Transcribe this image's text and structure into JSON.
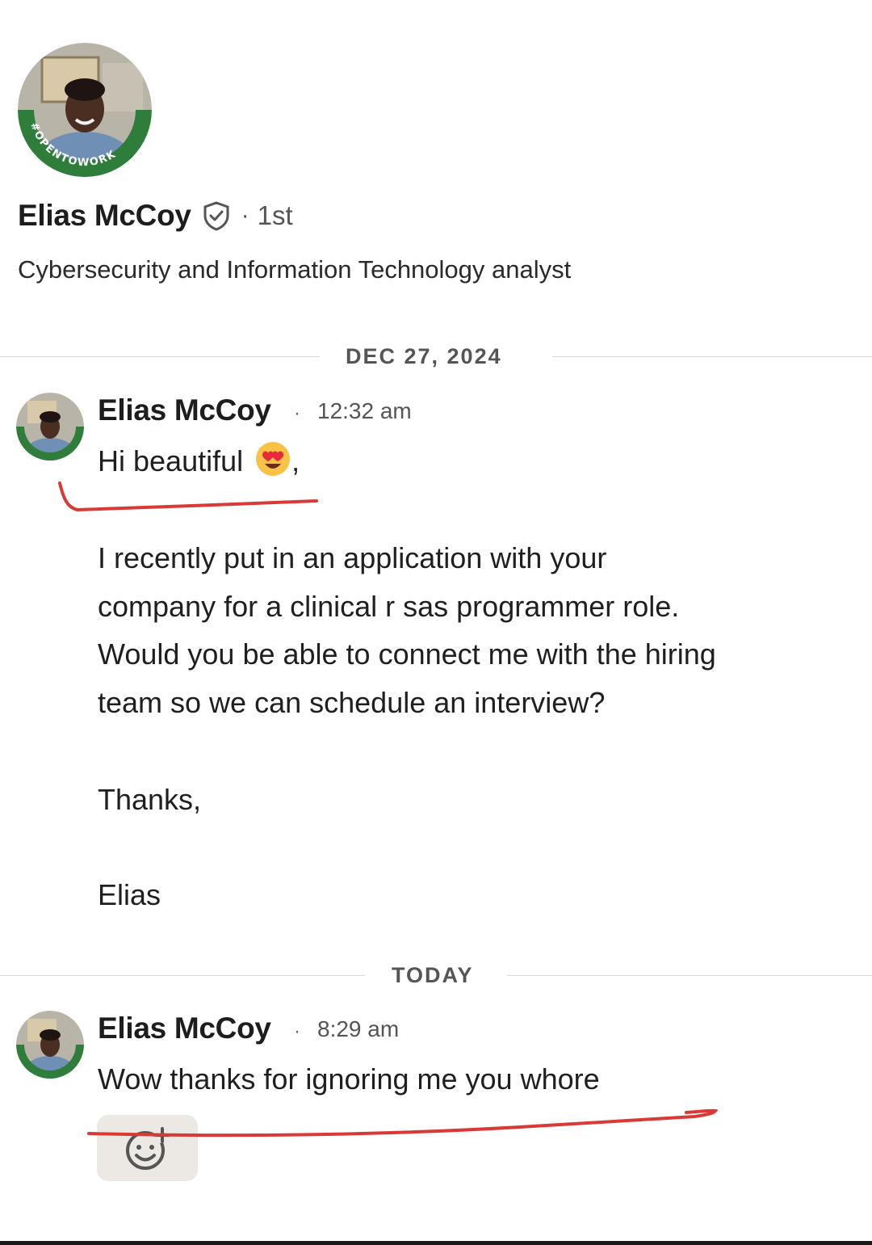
{
  "profile": {
    "name": "Elias McCoy",
    "badge_text": "#OPENTOWORK",
    "degree": "1st",
    "separator": "·",
    "headline": "Cybersecurity and Information Technology analyst"
  },
  "dividers": [
    {
      "label": "DEC 27, 2024"
    },
    {
      "label": "TODAY"
    }
  ],
  "messages": [
    {
      "sender": "Elias McCoy",
      "separator": "·",
      "time": "12:32 am",
      "greeting": "Hi beautiful",
      "greeting_emoji": "smiling-face-with-heart-eyes",
      "greeting_suffix": ",",
      "lines": [
        "I recently put in an application with your",
        "company for a clinical r sas programmer role.",
        "Would you be able to connect me with the hiring",
        "team so we can schedule an interview?"
      ],
      "signoff": "Thanks,",
      "signature": "Elias"
    },
    {
      "sender": "Elias McCoy",
      "separator": "·",
      "time": "8:29 am",
      "text": "Wow thanks for ignoring me you whore"
    }
  ],
  "reaction_button": {
    "icon": "add-reaction-icon"
  },
  "colors": {
    "opentowork_green": "#2f7d3a",
    "annotation_red": "#d93a36",
    "divider": "#d7d7d7",
    "reaction_bg": "#ece9e5"
  }
}
